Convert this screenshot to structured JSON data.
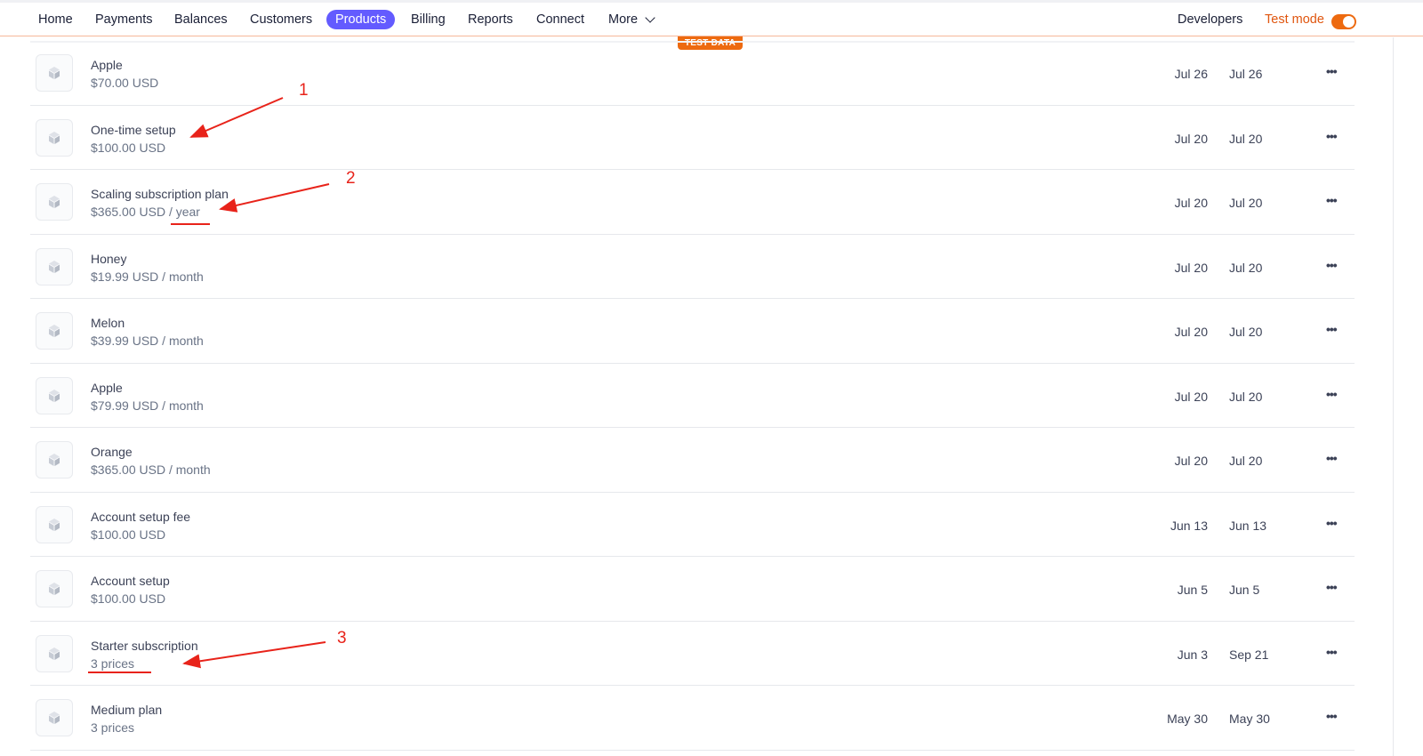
{
  "nav": {
    "items": [
      "Home",
      "Payments",
      "Balances",
      "Customers",
      "Products",
      "Billing",
      "Reports",
      "Connect",
      "More"
    ],
    "active": "Products",
    "developers": "Developers",
    "test_mode": "Test mode",
    "test_mode_on": true
  },
  "badge": "TEST DATA",
  "rows": [
    {
      "name": "Apple",
      "price": "$70.00 USD",
      "created": "Jul 26",
      "updated": "Jul 26"
    },
    {
      "name": "One-time setup",
      "price": "$100.00 USD",
      "created": "Jul 20",
      "updated": "Jul 20"
    },
    {
      "name": "Scaling subscription plan",
      "price": "$365.00 USD / year",
      "created": "Jul 20",
      "updated": "Jul 20"
    },
    {
      "name": "Honey",
      "price": "$19.99 USD / month",
      "created": "Jul 20",
      "updated": "Jul 20"
    },
    {
      "name": "Melon",
      "price": "$39.99 USD / month",
      "created": "Jul 20",
      "updated": "Jul 20"
    },
    {
      "name": "Apple",
      "price": "$79.99 USD / month",
      "created": "Jul 20",
      "updated": "Jul 20"
    },
    {
      "name": "Orange",
      "price": "$365.00 USD / month",
      "created": "Jul 20",
      "updated": "Jul 20"
    },
    {
      "name": "Account setup fee",
      "price": "$100.00 USD",
      "created": "Jun 13",
      "updated": "Jun 13"
    },
    {
      "name": "Account setup",
      "price": "$100.00 USD",
      "created": "Jun 5",
      "updated": "Jun 5"
    },
    {
      "name": "Starter subscription",
      "price": "3 prices",
      "created": "Jun 3",
      "updated": "Sep 21"
    },
    {
      "name": "Medium plan",
      "price": "3 prices",
      "created": "May 30",
      "updated": "May 30"
    }
  ],
  "more_icon": "ellipsis-icon",
  "annotations": [
    "1",
    "2",
    "3"
  ],
  "colors": {
    "accent": "#635bff",
    "test": "#ed6a10",
    "annotation": "#e8231a"
  }
}
